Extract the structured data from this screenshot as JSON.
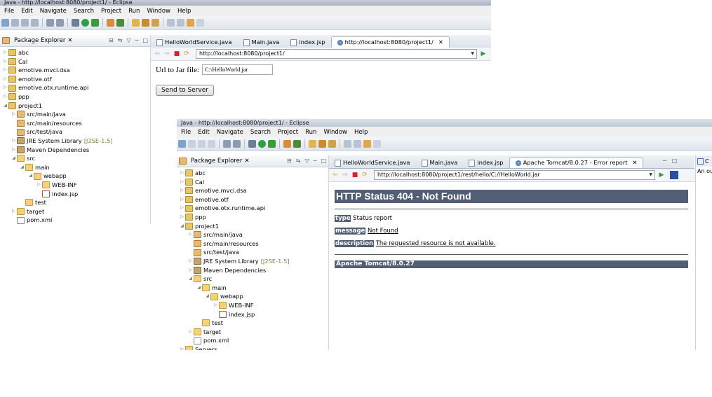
{
  "window1": {
    "title": "Java - http://localhost:8080/project1/ - Eclipse",
    "menu": [
      "File",
      "Edit",
      "Navigate",
      "Search",
      "Project",
      "Run",
      "Window",
      "Help"
    ],
    "package_explorer_label": "Package Explorer",
    "tree": [
      {
        "label": "abc",
        "icon": "project",
        "depth": 0,
        "arrow": "▷"
      },
      {
        "label": "Cal",
        "icon": "project",
        "depth": 0,
        "arrow": "▷"
      },
      {
        "label": "emotive.mvci.dsa",
        "icon": "project",
        "depth": 0,
        "arrow": "▷"
      },
      {
        "label": "emotive.otf",
        "icon": "project",
        "depth": 0,
        "arrow": "▷"
      },
      {
        "label": "emotive.otx.runtime.api",
        "icon": "project",
        "depth": 0,
        "arrow": "▷"
      },
      {
        "label": "ppp",
        "icon": "project",
        "depth": 0,
        "arrow": "▷"
      },
      {
        "label": "project1",
        "icon": "project",
        "depth": 0,
        "arrow": "◢"
      },
      {
        "label": "src/main/java",
        "icon": "package",
        "depth": 1,
        "arrow": "▷"
      },
      {
        "label": "src/main/resources",
        "icon": "package",
        "depth": 1,
        "arrow": ""
      },
      {
        "label": "src/test/java",
        "icon": "package",
        "depth": 1,
        "arrow": ""
      },
      {
        "label": "JRE System Library",
        "suffix": "[J2SE-1.5]",
        "icon": "library",
        "depth": 1,
        "arrow": "▷"
      },
      {
        "label": "Maven Dependencies",
        "icon": "library",
        "depth": 1,
        "arrow": "▷"
      },
      {
        "label": "src",
        "icon": "folder",
        "depth": 1,
        "arrow": "◢"
      },
      {
        "label": "main",
        "icon": "folder",
        "depth": 2,
        "arrow": "◢"
      },
      {
        "label": "webapp",
        "icon": "folder",
        "depth": 3,
        "arrow": "◢"
      },
      {
        "label": "WEB-INF",
        "icon": "folder",
        "depth": 4,
        "arrow": "▷"
      },
      {
        "label": "index.jsp",
        "icon": "jsp",
        "depth": 4,
        "arrow": ""
      },
      {
        "label": "test",
        "icon": "folder",
        "depth": 2,
        "arrow": ""
      },
      {
        "label": "target",
        "icon": "folder",
        "depth": 1,
        "arrow": "▷"
      },
      {
        "label": "pom.xml",
        "icon": "file",
        "depth": 1,
        "arrow": ""
      }
    ],
    "tabs": [
      {
        "label": "HelloWorldService.java",
        "active": false,
        "kind": "file"
      },
      {
        "label": "Main.java",
        "active": false,
        "kind": "file"
      },
      {
        "label": "index.jsp",
        "active": false,
        "kind": "file"
      },
      {
        "label": "http://localhost:8080/project1/",
        "active": true,
        "kind": "web"
      }
    ],
    "url": "http://localhost:8080/project1/",
    "form": {
      "label": "Url to Jar file:",
      "value": "C:\\HelloWorld.jar",
      "button": "Send to Server"
    }
  },
  "window2": {
    "title": "Java - http://localhost:8080/project1/ - Eclipse",
    "menu": [
      "File",
      "Edit",
      "Navigate",
      "Search",
      "Project",
      "Run",
      "Window",
      "Help"
    ],
    "package_explorer_label": "Package Explorer",
    "tree": [
      {
        "label": "abc",
        "icon": "project",
        "depth": 0,
        "arrow": "▷"
      },
      {
        "label": "Cal",
        "icon": "project",
        "depth": 0,
        "arrow": "▷"
      },
      {
        "label": "emotive.mvci.dsa",
        "icon": "project",
        "depth": 0,
        "arrow": "▷"
      },
      {
        "label": "emotive.otf",
        "icon": "project",
        "depth": 0,
        "arrow": "▷"
      },
      {
        "label": "emotive.otx.runtime.api",
        "icon": "project",
        "depth": 0,
        "arrow": "▷"
      },
      {
        "label": "ppp",
        "icon": "project",
        "depth": 0,
        "arrow": "▷"
      },
      {
        "label": "project1",
        "icon": "project",
        "depth": 0,
        "arrow": "◢"
      },
      {
        "label": "src/main/java",
        "icon": "package",
        "depth": 1,
        "arrow": "▷"
      },
      {
        "label": "src/main/resources",
        "icon": "package",
        "depth": 1,
        "arrow": ""
      },
      {
        "label": "src/test/java",
        "icon": "package",
        "depth": 1,
        "arrow": ""
      },
      {
        "label": "JRE System Library",
        "suffix": "[J2SE-1.5]",
        "icon": "library",
        "depth": 1,
        "arrow": "▷"
      },
      {
        "label": "Maven Dependencies",
        "icon": "library",
        "depth": 1,
        "arrow": "▷"
      },
      {
        "label": "src",
        "icon": "folder",
        "depth": 1,
        "arrow": "◢"
      },
      {
        "label": "main",
        "icon": "folder",
        "depth": 2,
        "arrow": "◢"
      },
      {
        "label": "webapp",
        "icon": "folder",
        "depth": 3,
        "arrow": "◢"
      },
      {
        "label": "WEB-INF",
        "icon": "folder",
        "depth": 4,
        "arrow": "▷"
      },
      {
        "label": "index.jsp",
        "icon": "jsp",
        "depth": 4,
        "arrow": ""
      },
      {
        "label": "test",
        "icon": "folder",
        "depth": 2,
        "arrow": ""
      },
      {
        "label": "target",
        "icon": "folder",
        "depth": 1,
        "arrow": "▷"
      },
      {
        "label": "pom.xml",
        "icon": "file",
        "depth": 1,
        "arrow": ""
      },
      {
        "label": "Servers",
        "icon": "folder",
        "depth": 0,
        "arrow": "▷"
      }
    ],
    "tabs": [
      {
        "label": "HelloWorldService.java",
        "active": false,
        "kind": "file"
      },
      {
        "label": "Main.java",
        "active": false,
        "kind": "file"
      },
      {
        "label": "index.jsp",
        "active": false,
        "kind": "file"
      },
      {
        "label": "Apache Tomcat/8.0.27 - Error report",
        "active": true,
        "kind": "web"
      }
    ],
    "url": "http://localhost:8080/project1/rest/hello/C://HelloWorld.jar",
    "error": {
      "heading": "HTTP Status 404 - Not Found",
      "type_label": "type",
      "type_value": "Status report",
      "message_label": "message",
      "message_value": "Not Found",
      "description_label": "description",
      "description_value": "The requested resource is not available.",
      "footer": "Apache Tomcat/8.0.27"
    },
    "side_panel": {
      "tab_label": "C",
      "text": "An ou"
    }
  },
  "colors": {
    "tomcat_header": "#525d76",
    "eclipse_toolbar": "#dfe5ec"
  }
}
